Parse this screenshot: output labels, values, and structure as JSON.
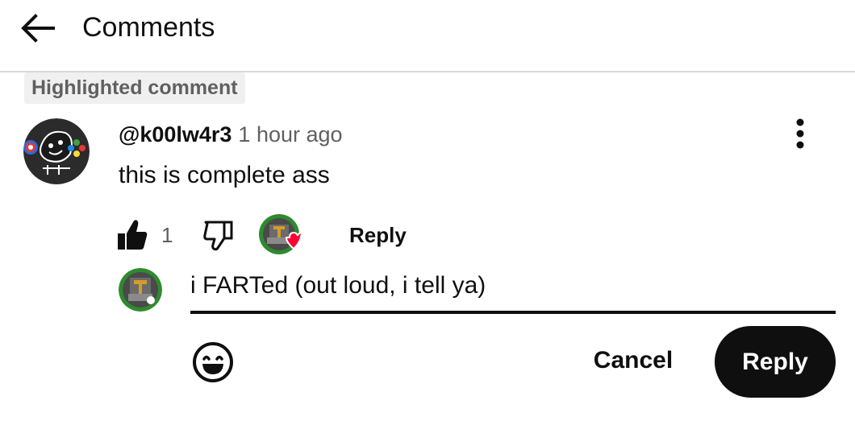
{
  "header": {
    "title": "Comments",
    "back_icon": "arrow-left-icon"
  },
  "highlight_badge": "Highlighted comment",
  "comment": {
    "author": "@k00lw4r3",
    "time": "1 hour ago",
    "text": "this is complete ass",
    "like_count": "1",
    "reply_label": "Reply",
    "menu_icon": "more-vertical-icon",
    "creator_heart": true
  },
  "reply_box": {
    "value": "i FARTed (out loud, i tell ya)",
    "emoji_icon": "smiley-icon",
    "cancel_label": "Cancel",
    "submit_label": "Reply"
  },
  "colors": {
    "text": "#0f0f0f",
    "secondary_text": "#606060",
    "heart_red": "#ff0033",
    "avatar_green": "#2e8b2e",
    "button_dark": "#0f0f0f"
  }
}
